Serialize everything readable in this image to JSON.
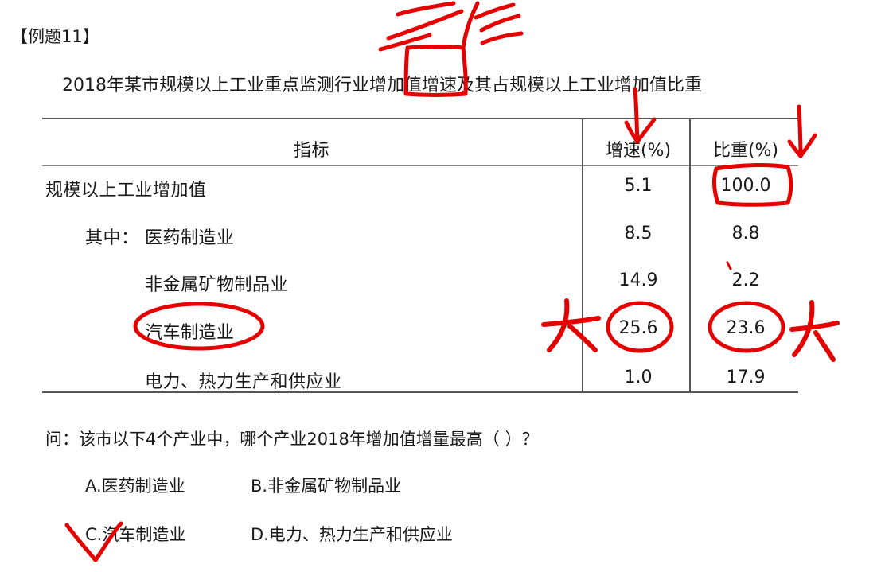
{
  "example_label": "【例题11】",
  "table_title": "2018年某市规模以上工业重点监测行业增加值增速及其占规模以上工业增加值比重",
  "table": {
    "headers": {
      "indicator": "指标",
      "growth": "增速(%)",
      "share": "比重(%)"
    },
    "rows": [
      {
        "name": "规模以上工业增加值",
        "growth": "5.1",
        "share": "100.0"
      },
      {
        "prefix": "其中：",
        "name": "医药制造业",
        "growth": "8.5",
        "share": "8.8"
      },
      {
        "name": "非金属矿物制品业",
        "growth": "14.9",
        "share": "2.2"
      },
      {
        "name": "汽车制造业",
        "growth": "25.6",
        "share": "23.6"
      },
      {
        "name": "电力、热力生产和供应业",
        "growth": "1.0",
        "share": "17.9"
      }
    ]
  },
  "question": "问：该市以下4个产业中，哪个产业2018年增加值增量最高（    ）？",
  "options": {
    "a": "A.医药制造业",
    "b": "B.非金属矿物制品业",
    "c": "C.汽车制造业",
    "d": "D.电力、热力生产和供应业"
  },
  "annotations": {
    "ink_color": "#e50000",
    "marks": [
      "大",
      "大"
    ],
    "scribble": "增值"
  }
}
